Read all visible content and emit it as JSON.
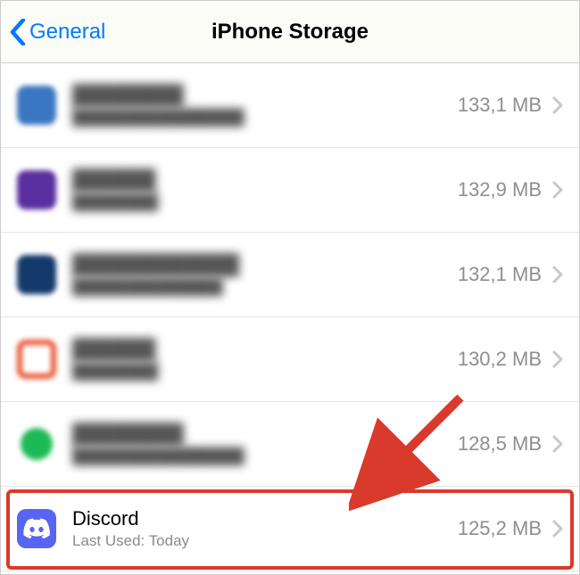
{
  "header": {
    "back_label": "General",
    "title": "iPhone Storage"
  },
  "apps": [
    {
      "name": "████████",
      "sub": "████████████████",
      "size": "133,1 MB",
      "icon_class": "icon-blue-sq",
      "blurred": true
    },
    {
      "name": "██████",
      "sub": "████████",
      "size": "132,9 MB",
      "icon_class": "icon-purple-sq",
      "blurred": true
    },
    {
      "name": "████████████",
      "sub": "██████████████",
      "size": "132,1 MB",
      "icon_class": "icon-darkblue-sq",
      "blurred": true
    },
    {
      "name": "██████",
      "sub": "████████",
      "size": "130,2 MB",
      "icon_class": "icon-orange-sq",
      "blurred": true
    },
    {
      "name": "████████",
      "sub": "████████████████",
      "size": "128,5 MB",
      "icon_class": "icon-green-circle",
      "blurred": true
    },
    {
      "name": "Discord",
      "sub": "Last Used: Today",
      "size": "125,2 MB",
      "icon_class": "icon-discord",
      "blurred": false
    }
  ],
  "colors": {
    "accent": "#007aff",
    "highlight": "#d93a2b"
  }
}
